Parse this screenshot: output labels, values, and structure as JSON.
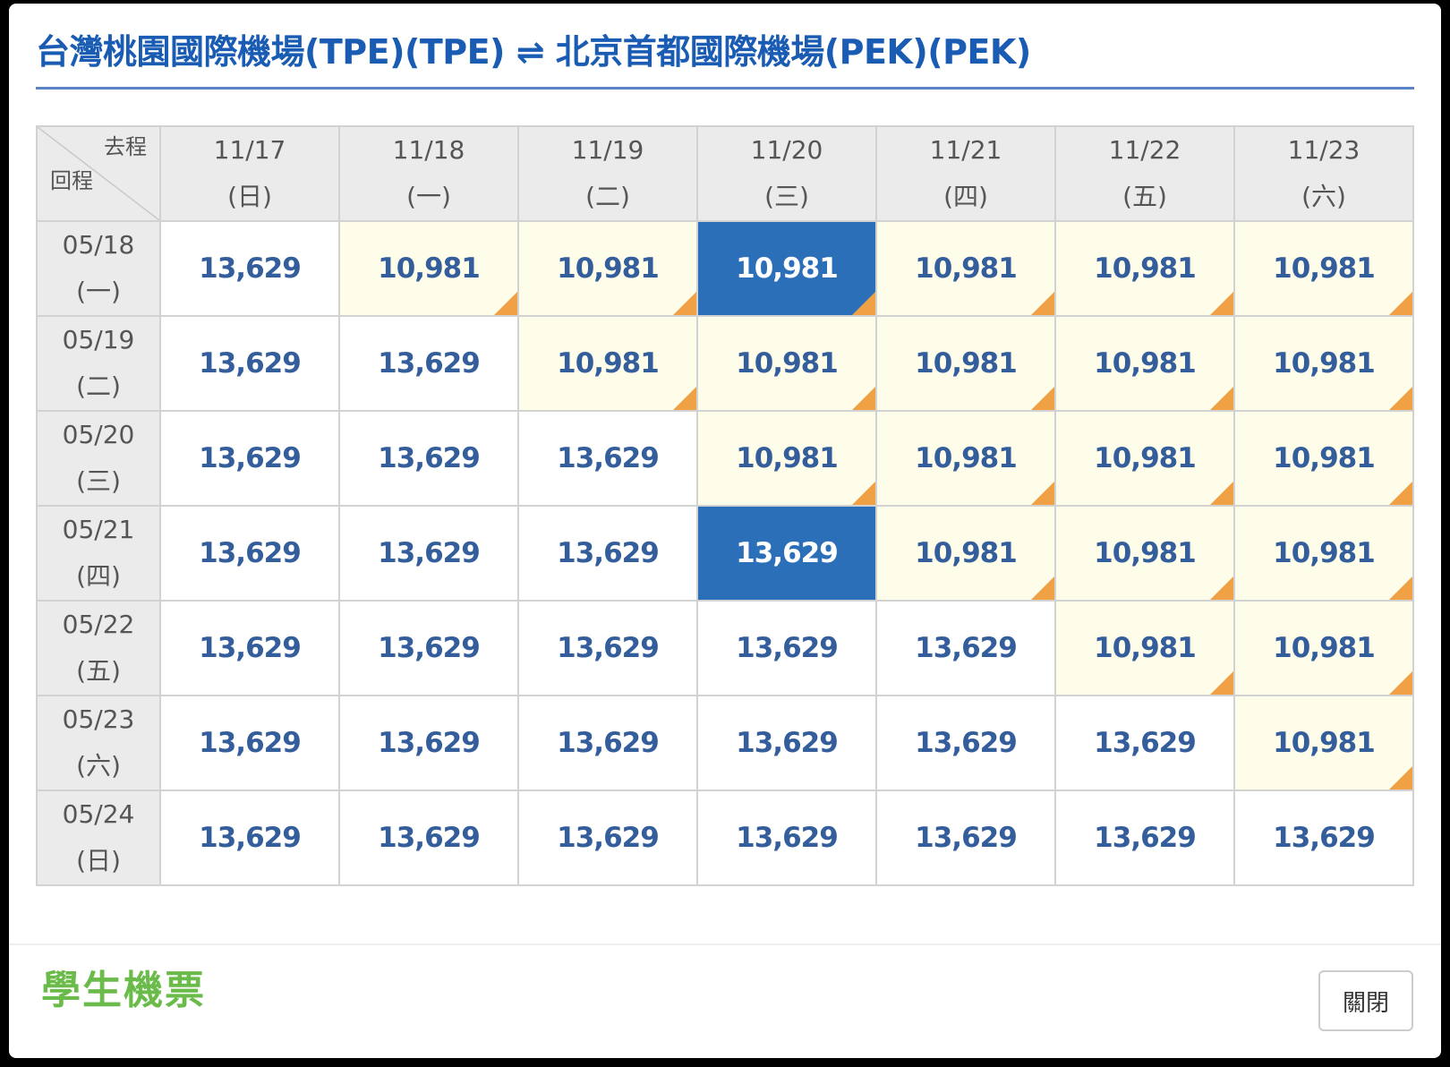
{
  "title": "台灣桃園國際機場(TPE)(TPE) ⇌ 北京首都國際機場(PEK)(PEK)",
  "corner": {
    "outbound": "去程",
    "return": "回程"
  },
  "columns": [
    {
      "date": "11/17",
      "weekday": "(日)"
    },
    {
      "date": "11/18",
      "weekday": "(一)"
    },
    {
      "date": "11/19",
      "weekday": "(二)"
    },
    {
      "date": "11/20",
      "weekday": "(三)"
    },
    {
      "date": "11/21",
      "weekday": "(四)"
    },
    {
      "date": "11/22",
      "weekday": "(五)"
    },
    {
      "date": "11/23",
      "weekday": "(六)"
    }
  ],
  "rows": [
    {
      "date": "05/18",
      "weekday": "(一)",
      "prices": [
        "13,629",
        "10,981",
        "10,981",
        "10,981",
        "10,981",
        "10,981",
        "10,981"
      ]
    },
    {
      "date": "05/19",
      "weekday": "(二)",
      "prices": [
        "13,629",
        "13,629",
        "10,981",
        "10,981",
        "10,981",
        "10,981",
        "10,981"
      ]
    },
    {
      "date": "05/20",
      "weekday": "(三)",
      "prices": [
        "13,629",
        "13,629",
        "13,629",
        "10,981",
        "10,981",
        "10,981",
        "10,981"
      ]
    },
    {
      "date": "05/21",
      "weekday": "(四)",
      "prices": [
        "13,629",
        "13,629",
        "13,629",
        "13,629",
        "10,981",
        "10,981",
        "10,981"
      ]
    },
    {
      "date": "05/22",
      "weekday": "(五)",
      "prices": [
        "13,629",
        "13,629",
        "13,629",
        "13,629",
        "13,629",
        "10,981",
        "10,981"
      ]
    },
    {
      "date": "05/23",
      "weekday": "(六)",
      "prices": [
        "13,629",
        "13,629",
        "13,629",
        "13,629",
        "13,629",
        "13,629",
        "10,981"
      ]
    },
    {
      "date": "05/24",
      "weekday": "(日)",
      "prices": [
        "13,629",
        "13,629",
        "13,629",
        "13,629",
        "13,629",
        "13,629",
        "13,629"
      ]
    }
  ],
  "lowest_price": "10,981",
  "selected_cells": [
    {
      "row": 0,
      "col": 3
    },
    {
      "row": 3,
      "col": 3
    }
  ],
  "colors": {
    "title": "#1a5cb3",
    "selected": "#2b6fb9",
    "cheap_bg": "#fefde9",
    "cheap_marker": "#f0a045",
    "price_text": "#345e9b",
    "student": "#6bbb4a"
  },
  "footer": {
    "student_label": "學生機票",
    "close_label": "關閉"
  }
}
